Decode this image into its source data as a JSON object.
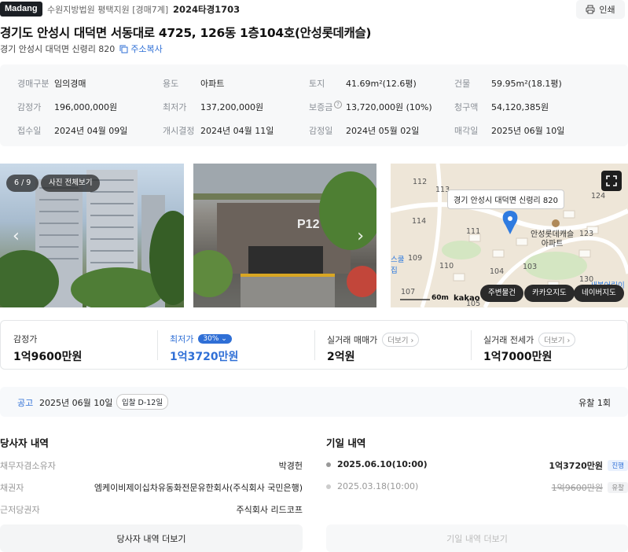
{
  "header": {
    "logo": "Madang",
    "court": "수원지방법원 평택지원 [경매7계]",
    "case_no": "2024타경1703",
    "print_label": "인쇄"
  },
  "address": {
    "title": "경기도 안성시 대덕면 서동대로 4725, 126동 1층104호(안성롯데캐슬)",
    "lot": "경기 안성시 대덕면 신령리 820",
    "copy_label": "주소복사"
  },
  "info": {
    "r1": [
      {
        "label": "경매구분",
        "value": "임의경매"
      },
      {
        "label": "용도",
        "value": "아파트"
      },
      {
        "label": "토지",
        "value": "41.69m²(12.6평)"
      },
      {
        "label": "건물",
        "value": "59.95m²(18.1평)"
      }
    ],
    "r2": [
      {
        "label": "감정가",
        "value": "196,000,000원"
      },
      {
        "label": "최저가",
        "value": "137,200,000원"
      },
      {
        "label": "보증금",
        "value": "13,720,000원 (10%)"
      },
      {
        "label": "청구액",
        "value": "54,120,385원"
      }
    ],
    "r3": [
      {
        "label": "접수일",
        "value": "2024년 04월 09일"
      },
      {
        "label": "개시결정",
        "value": "2024년 04월 11일"
      },
      {
        "label": "감정일",
        "value": "2024년 05월 02일"
      },
      {
        "label": "매각일",
        "value": "2025년 06월 10일"
      }
    ]
  },
  "gallery": {
    "counter": "6 / 9",
    "all_photos": "사진 전체보기",
    "sign_text": "P12"
  },
  "map": {
    "label": "경기 안성시 대덕면 신령리 820",
    "place": "안성롯데캐슬\n아파트",
    "place_line1": "안성롯데캐슬",
    "place_line2": "아파트",
    "scale": "60m",
    "brand": "kakao",
    "btn_nearby": "주변물건",
    "btn_kakao": "카카오지도",
    "btn_naver": "네이버지도",
    "nums": [
      "113",
      "114",
      "111",
      "109",
      "110",
      "104",
      "103",
      "107",
      "105",
      "123",
      "124",
      "130",
      "112"
    ],
    "side_left": "스쿨",
    "side_left2": "집",
    "side_right": "새봄어린이"
  },
  "prices": {
    "appraisal": {
      "label": "감정가",
      "value": "1억9600만원"
    },
    "minimum": {
      "label": "최저가",
      "badge": "30%",
      "value": "1억3720만원"
    },
    "sale": {
      "label": "실거래 매매가",
      "more": "더보기",
      "value": "2억원"
    },
    "jeonse": {
      "label": "실거래 전세가",
      "more": "더보기",
      "value": "1억7000만원"
    }
  },
  "notice": {
    "label": "공고",
    "date": "2025년 06월 10일",
    "dday": "입찰 D-12일",
    "fail": "유찰 1회"
  },
  "parties": {
    "title": "당사자 내역",
    "rows": [
      {
        "label": "채무자겸소유자",
        "value": "박경헌"
      },
      {
        "label": "채권자",
        "value": "엠케이비제이십차유동화전문유한회사(주식회사 국민은행)"
      },
      {
        "label": "근저당권자",
        "value": "주식회사 리드코프"
      }
    ],
    "more": "당사자 내역 더보기"
  },
  "history": {
    "title": "기일 내역",
    "rows": [
      {
        "date": "2025.06.10(10:00)",
        "price": "1억3720만원",
        "status": "진행"
      },
      {
        "date": "2025.03.18(10:00)",
        "price": "1억9600만원",
        "status": "유찰"
      }
    ],
    "more": "기일 내역 더보기"
  },
  "colors": {
    "accent": "#2f6fd6",
    "pin": "#2f7be0"
  }
}
